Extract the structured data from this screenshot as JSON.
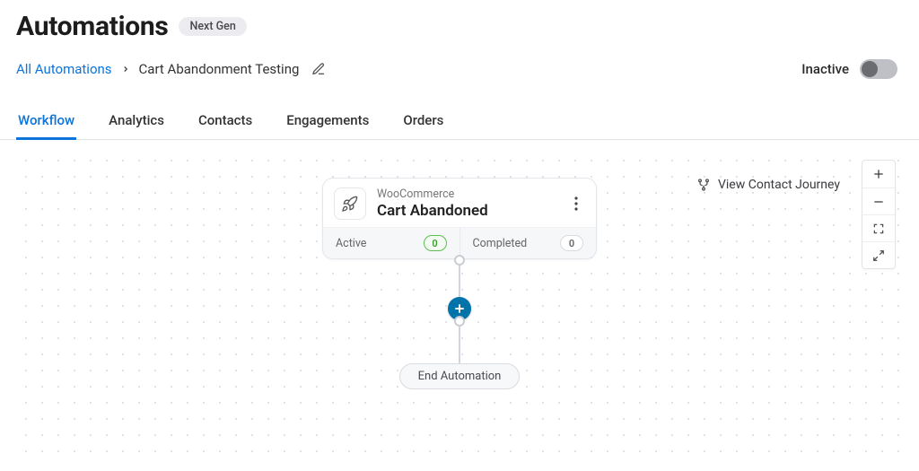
{
  "header": {
    "title": "Automations",
    "badge": "Next Gen"
  },
  "breadcrumb": {
    "root": "All Automations",
    "current": "Cart Abandonment Testing"
  },
  "status": {
    "label": "Inactive",
    "active": false
  },
  "tabs": [
    {
      "id": "workflow",
      "label": "Workflow",
      "active": true
    },
    {
      "id": "analytics",
      "label": "Analytics",
      "active": false
    },
    {
      "id": "contacts",
      "label": "Contacts",
      "active": false
    },
    {
      "id": "engagements",
      "label": "Engagements",
      "active": false
    },
    {
      "id": "orders",
      "label": "Orders",
      "active": false
    }
  ],
  "canvas": {
    "journey_link": "View Contact Journey",
    "trigger_node": {
      "icon": "rocket",
      "subtitle": "WooCommerce",
      "title": "Cart Abandoned",
      "stats": {
        "active": {
          "label": "Active",
          "value": "0"
        },
        "completed": {
          "label": "Completed",
          "value": "0"
        }
      }
    },
    "end_label": "End Automation"
  }
}
